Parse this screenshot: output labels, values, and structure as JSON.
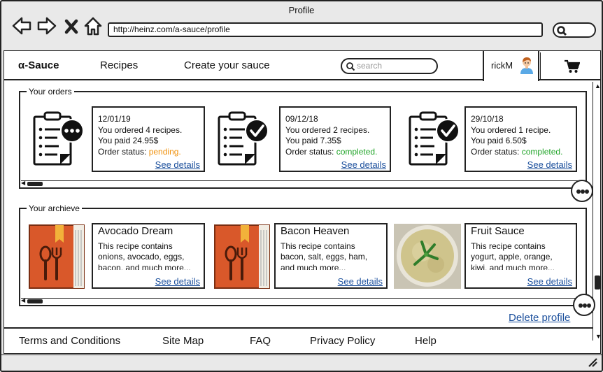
{
  "window": {
    "title": "Profile"
  },
  "browser": {
    "url": "http://heinz.com/a-sauce/profile"
  },
  "navbar": {
    "logo": "α-Sauce",
    "recipes": "Recipes",
    "create": "Create your sauce",
    "search_placeholder": "search",
    "username": "rickM"
  },
  "orders": {
    "legend": "Your orders",
    "items": [
      {
        "date": "12/01/19",
        "ordered": "You ordered 4 recipes.",
        "paid": "You paid 24.95$",
        "status_label": "Order status: ",
        "status": "pending.",
        "link": "See details"
      },
      {
        "date": "09/12/18",
        "ordered": "You ordered 2 recipes.",
        "paid": "You paid 7.35$",
        "status_label": "Order status: ",
        "status": "completed.",
        "link": "See details"
      },
      {
        "date": "29/10/18",
        "ordered": "You ordered 1 recipe.",
        "paid": "You paid 6.50$",
        "status_label": "Order status: ",
        "status": "completed.",
        "link": "See details"
      }
    ]
  },
  "archive": {
    "legend": "Your archieve",
    "items": [
      {
        "title": "Avocado Dream",
        "desc": "This recipe contains onions, avocado, eggs, bacon, and much more...",
        "link": "See details"
      },
      {
        "title": "Bacon Heaven",
        "desc": "This recipe contains bacon, salt, eggs, ham, and much more...",
        "link": "See details"
      },
      {
        "title": "Fruit Sauce",
        "desc": "This recipe contains yogurt, apple, orange, kiwi, and much more...",
        "link": "See details"
      }
    ]
  },
  "delete_profile": "Delete profile",
  "footer": {
    "terms": "Terms and Conditions",
    "sitemap": "Site Map",
    "faq": "FAQ",
    "privacy": "Privacy Policy",
    "help": "Help"
  },
  "colors": {
    "pending": "#f0900a",
    "completed": "#22a52a",
    "link": "#1b4f9c",
    "book": "#d9582a"
  }
}
